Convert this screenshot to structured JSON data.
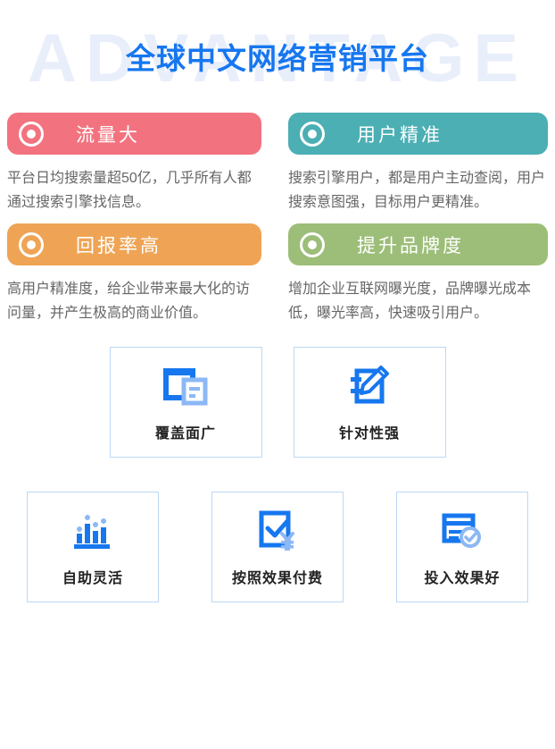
{
  "header": {
    "watermark": "ADVANTAGE",
    "title": "全球中文网络营销平台",
    "dot_top_left": "decorative-dot",
    "dot_bottom_right": "decorative-dot"
  },
  "features": [
    {
      "label": "流量大",
      "color": "#F2737F",
      "icon": "bullseye-icon",
      "desc": "平台日均搜索量超50亿，几乎所有人都通过搜索引擎找信息。"
    },
    {
      "label": "用户精准",
      "color": "#4BAFB4",
      "icon": "bullseye-icon",
      "desc": "搜索引擎用户，都是用户主动查阅，用户搜索意图强，目标用户更精准。"
    },
    {
      "label": "回报率高",
      "color": "#EFA455",
      "icon": "bullseye-icon",
      "desc": "高用户精准度，给企业带来最大化的访问量，并产生极高的商业价值。"
    },
    {
      "label": "提升品牌度",
      "color": "#9CBE78",
      "icon": "bullseye-icon",
      "desc": "增加企业互联网曝光度，品牌曝光成本低，曝光率高，快速吸引用户。"
    }
  ],
  "icon_boxes_row1": [
    {
      "caption": "覆盖面广",
      "icon": "window-document-icon"
    },
    {
      "caption": "针对性强",
      "icon": "edit-pencil-icon"
    }
  ],
  "icon_boxes_row2": [
    {
      "caption": "自助灵活",
      "icon": "bar-chart-icon"
    },
    {
      "caption": "按照效果付费",
      "icon": "checkbox-yuan-icon"
    },
    {
      "caption": "投入效果好",
      "icon": "card-check-icon"
    }
  ],
  "theme": {
    "primary_blue": "#1677EF",
    "light_blue": "#8CB8F5",
    "watermark_blue": "#E9EEFB",
    "box_border": "#BCD8F5",
    "body_text": "#666666"
  }
}
